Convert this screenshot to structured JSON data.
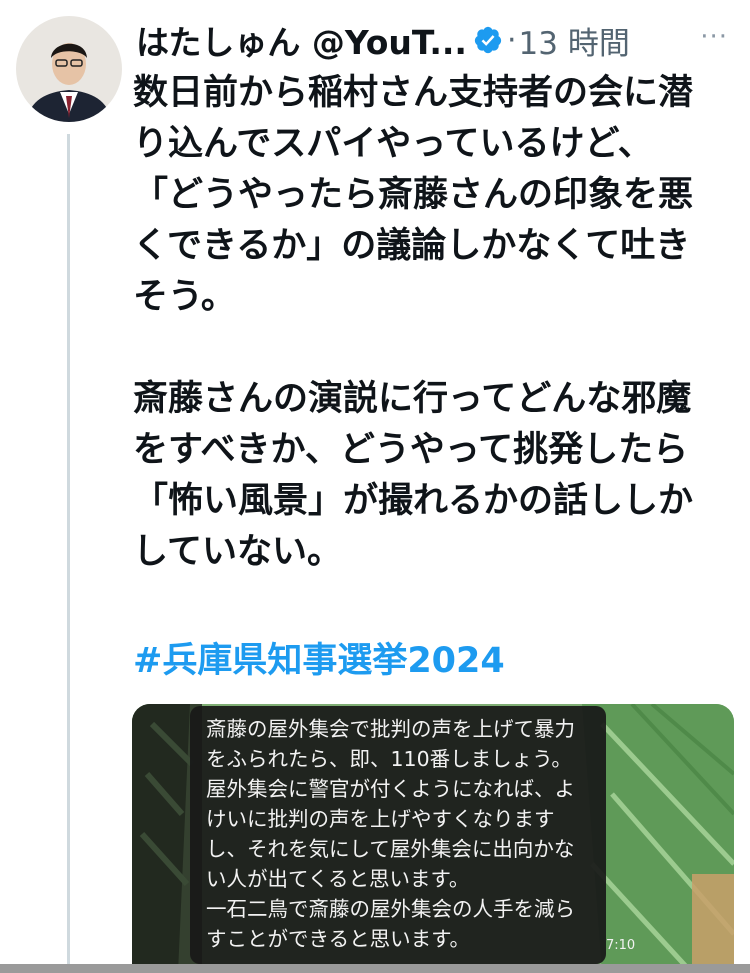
{
  "tweet": {
    "author_name": "はたしゅん @YouT...",
    "verified": true,
    "separator": "·",
    "time": "13 時間",
    "more_label": "···",
    "paragraphs": [
      "数日前から稲村さん支持者の会に潜\nり込んでスパイやっているけど、\n「どうやったら斎藤さんの印象を悪\nくできるか」の議論しかなくて吐き\nそう。",
      "斎藤さんの演説に行ってどんな邪魔\nをすべきか、どうやって挑発したら\n「怖い風景」が撮れるかの話ししか\nしていない。"
    ],
    "hashtag": "#兵庫県知事選挙2024",
    "media": {
      "caption": "斎藤の屋外集会で批判の声を上げて暴力\nをふられたら、即、110番しましょう。\n屋外集会に警官が付くようになれば、よ\nけいに批判の声を上げやすくなります\nし、それを気にして屋外集会に出向かな\nい人が出てくると思います。\n一石二鳥で斎藤の屋外集会の人手を減ら\nすことができると思います。",
      "duration": "7:10"
    }
  },
  "colors": {
    "hashtag": "#1d9bf0",
    "verified": "#1d9bf0",
    "muted": "#536471"
  },
  "icons": {
    "verified": "verified-badge-icon",
    "more": "more-horizontal-icon"
  }
}
